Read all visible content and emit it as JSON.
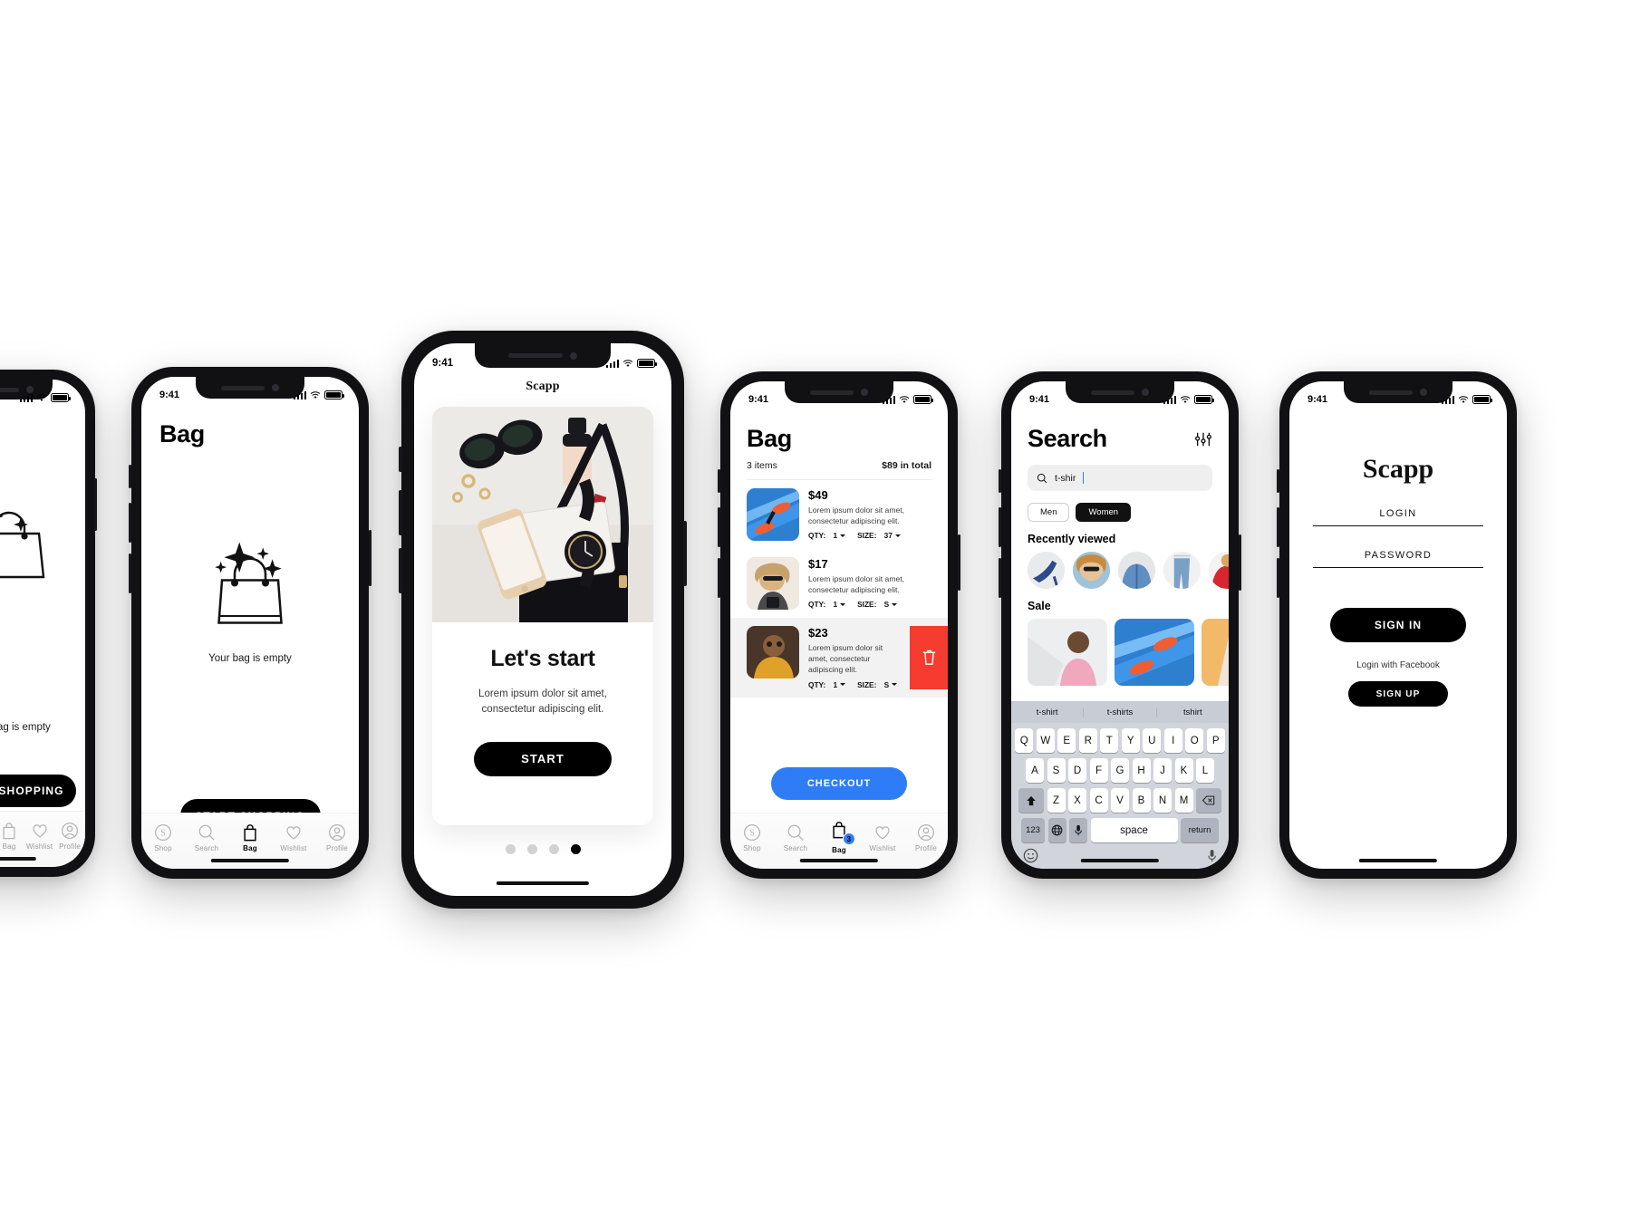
{
  "app": {
    "name": "Scapp",
    "status_time": "9:41"
  },
  "tabbar": {
    "items": [
      {
        "label": "Shop",
        "icon": "shop-s-icon"
      },
      {
        "label": "Search",
        "icon": "search-icon"
      },
      {
        "label": "Bag",
        "icon": "bag-icon"
      },
      {
        "label": "Wishlist",
        "icon": "heart-icon"
      },
      {
        "label": "Profile",
        "icon": "profile-icon"
      }
    ]
  },
  "screen_empty_bag": {
    "title": "Bag",
    "caption": "Your bag is empty",
    "cta": "START SHOPPING",
    "active_tab": "Bag"
  },
  "screen_onboarding": {
    "app_title": "Scapp",
    "heading": "Let's start",
    "body": "Lorem ipsum dolor sit amet, consectetur adipiscing elit.",
    "cta": "START",
    "dots": 4,
    "active_dot": 4
  },
  "screen_bag": {
    "title": "Bag",
    "items_count": "3 items",
    "total": "$89 in total",
    "qty_label": "QTY:",
    "size_label": "SIZE:",
    "items": [
      {
        "price": "$49",
        "desc": "Lorem ipsum dolor sit amet, consectetur adipiscing elit.",
        "qty": "1",
        "size": "37",
        "swiped": false
      },
      {
        "price": "$17",
        "desc": "Lorem ipsum dolor sit amet, consectetur adipiscing elit.",
        "qty": "1",
        "size": "S",
        "swiped": false
      },
      {
        "price": "$23",
        "desc": "Lorem ipsum dolor sit amet, consectetur adipiscing elit.",
        "qty": "1",
        "size": "S",
        "swiped": true
      }
    ],
    "delete_icon": "trash-icon",
    "checkout": "CHECKOUT",
    "bag_badge": "3",
    "active_tab": "Bag"
  },
  "screen_search": {
    "title": "Search",
    "filter_icon": "sliders-icon",
    "search_value": "t-shir",
    "search_icon": "search-icon",
    "segments": [
      {
        "label": "Men",
        "selected": false
      },
      {
        "label": "Women",
        "selected": true
      }
    ],
    "recently_viewed_title": "Recently viewed",
    "sale_title": "Sale",
    "suggestions": [
      "t-shirt",
      "t-shirts",
      "tshirt"
    ],
    "keyboard": {
      "row1": [
        "Q",
        "W",
        "E",
        "R",
        "T",
        "Y",
        "U",
        "I",
        "O",
        "P"
      ],
      "row2": [
        "A",
        "S",
        "D",
        "F",
        "G",
        "H",
        "J",
        "K",
        "L"
      ],
      "row3": [
        "Z",
        "X",
        "C",
        "V",
        "B",
        "N",
        "M"
      ],
      "shift_icon": "shift-icon",
      "backspace_icon": "backspace-icon",
      "numbers_key": "123",
      "globe_icon": "globe-icon",
      "mic_icon": "mic-icon",
      "space_key": "space",
      "return_key": "return",
      "emoji_icon": "emoji-icon",
      "dictation_icon": "mic-icon"
    }
  },
  "screen_login": {
    "brand": "Scapp",
    "login_label": "LOGIN",
    "password_label": "PASSWORD",
    "sign_in": "SIGN IN",
    "facebook_text": "Login with Facebook",
    "sign_up": "SIGN UP"
  },
  "colors": {
    "accent_blue": "#2f7df6",
    "delete_red": "#f63b30",
    "black": "#000000"
  }
}
